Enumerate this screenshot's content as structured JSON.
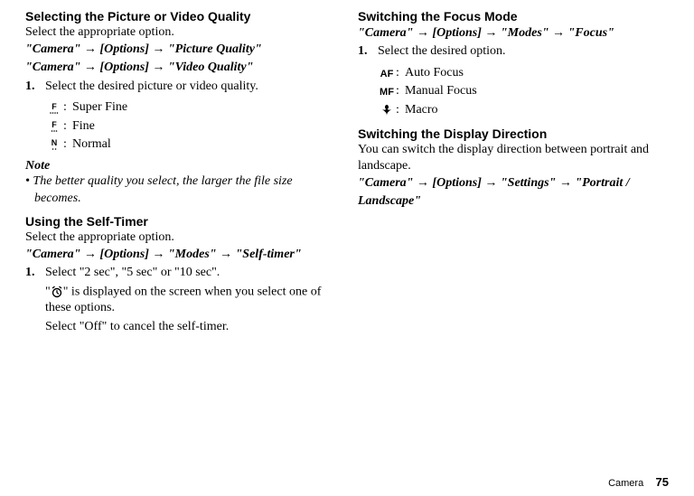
{
  "footer": {
    "section": "Camera",
    "page": "75"
  },
  "left": {
    "sec1": {
      "heading": "Selecting the Picture or Video Quality",
      "intro": "Select the appropriate option.",
      "path1": "\"Camera\" → [Options] → \"Picture Quality\"",
      "path2": "\"Camera\" → [Options] → \"Video Quality\"",
      "step1": "Select the desired picture or video quality.",
      "items": {
        "a": "Super Fine",
        "b": "Fine",
        "c": "Normal"
      },
      "noteLabel": "Note",
      "noteBullet": "• ",
      "noteBody": "The better quality you select, the larger the file size becomes."
    },
    "sec2": {
      "heading": "Using the Self-Timer",
      "intro": "Select the appropriate option.",
      "path": "\"Camera\" → [Options] → \"Modes\" → \"Self-timer\"",
      "step1": "Select \"2 sec\", \"5 sec\" or \"10 sec\".",
      "desc_pre": "\"",
      "desc_post": "\" is displayed on the screen when you select one of these options.",
      "desc2": "Select \"Off\" to cancel the self-timer."
    }
  },
  "right": {
    "sec1": {
      "heading": "Switching the Focus Mode",
      "path": "\"Camera\" → [Options] → \"Modes\" → \"Focus\"",
      "step1": "Select the desired option.",
      "items": {
        "a": "Auto Focus",
        "b": "Manual Focus",
        "c": "Macro"
      }
    },
    "sec2": {
      "heading": "Switching the Display Direction",
      "body": "You can switch the display direction between portrait and landscape.",
      "path": "\"Camera\" → [Options] → \"Settings\" → \"Portrait / Landscape\""
    }
  }
}
